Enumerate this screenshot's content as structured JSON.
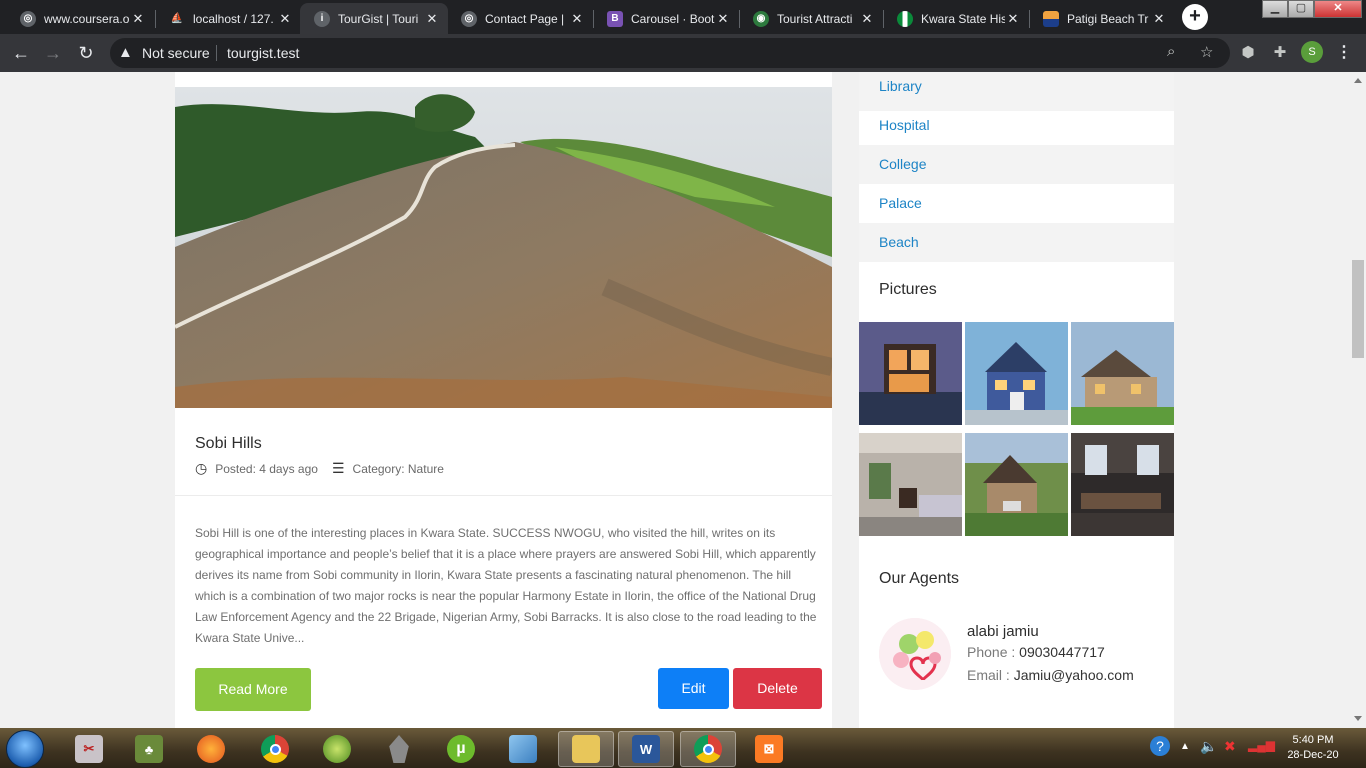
{
  "browser": {
    "tabs": [
      {
        "title": "www.coursera.o",
        "active": false
      },
      {
        "title": "localhost / 127.",
        "active": false
      },
      {
        "title": "TourGist | Touri",
        "active": true
      },
      {
        "title": "Contact Page |",
        "active": false
      },
      {
        "title": "Carousel · Boot",
        "active": false
      },
      {
        "title": "Tourist Attracti",
        "active": false
      },
      {
        "title": "Kwara State His",
        "active": false
      },
      {
        "title": "Patigi Beach Tr",
        "active": false
      }
    ],
    "address": {
      "security_label": "Not secure",
      "url": "tourgist.test"
    },
    "profile_initial": "S"
  },
  "post": {
    "title": "Sobi Hills",
    "posted": "Posted: 4 days ago",
    "category": "Category: Nature",
    "excerpt": "Sobi Hill is one of the interesting places in Kwara State. SUCCESS NWOGU, who visited the hill, writes on its geographical importance and people’s belief that it is a place where prayers are answered Sobi Hill, which apparently derives its name from Sobi community in Ilorin, Kwara State presents a fascinating natural phenomenon. The hill which is a combination of two major rocks is near the popular Harmony Estate in Ilorin, the office of the National Drug Law Enforcement Agency and the 22 Brigade, Nigerian Army, Sobi Barracks. It is also close to the road leading to the Kwara State Unive...",
    "read_more_label": "Read More",
    "edit_label": "Edit",
    "delete_label": "Delete"
  },
  "sidebar": {
    "categories": [
      "Library",
      "Hospital",
      "College",
      "Palace",
      "Beach"
    ],
    "pictures_heading": "Pictures",
    "agents_heading": "Our Agents",
    "agent": {
      "name": "alabi jamiu",
      "phone_label": "Phone :",
      "phone": "09030447717",
      "email_label": "Email :",
      "email": "Jamiu@yahoo.com"
    }
  },
  "taskbar": {
    "time": "5:40 PM",
    "date": "28-Dec-20"
  },
  "colors": {
    "link": "#1d84c6",
    "read_more": "#8cc63f",
    "edit": "#0d7ff7",
    "delete": "#dc3545"
  }
}
